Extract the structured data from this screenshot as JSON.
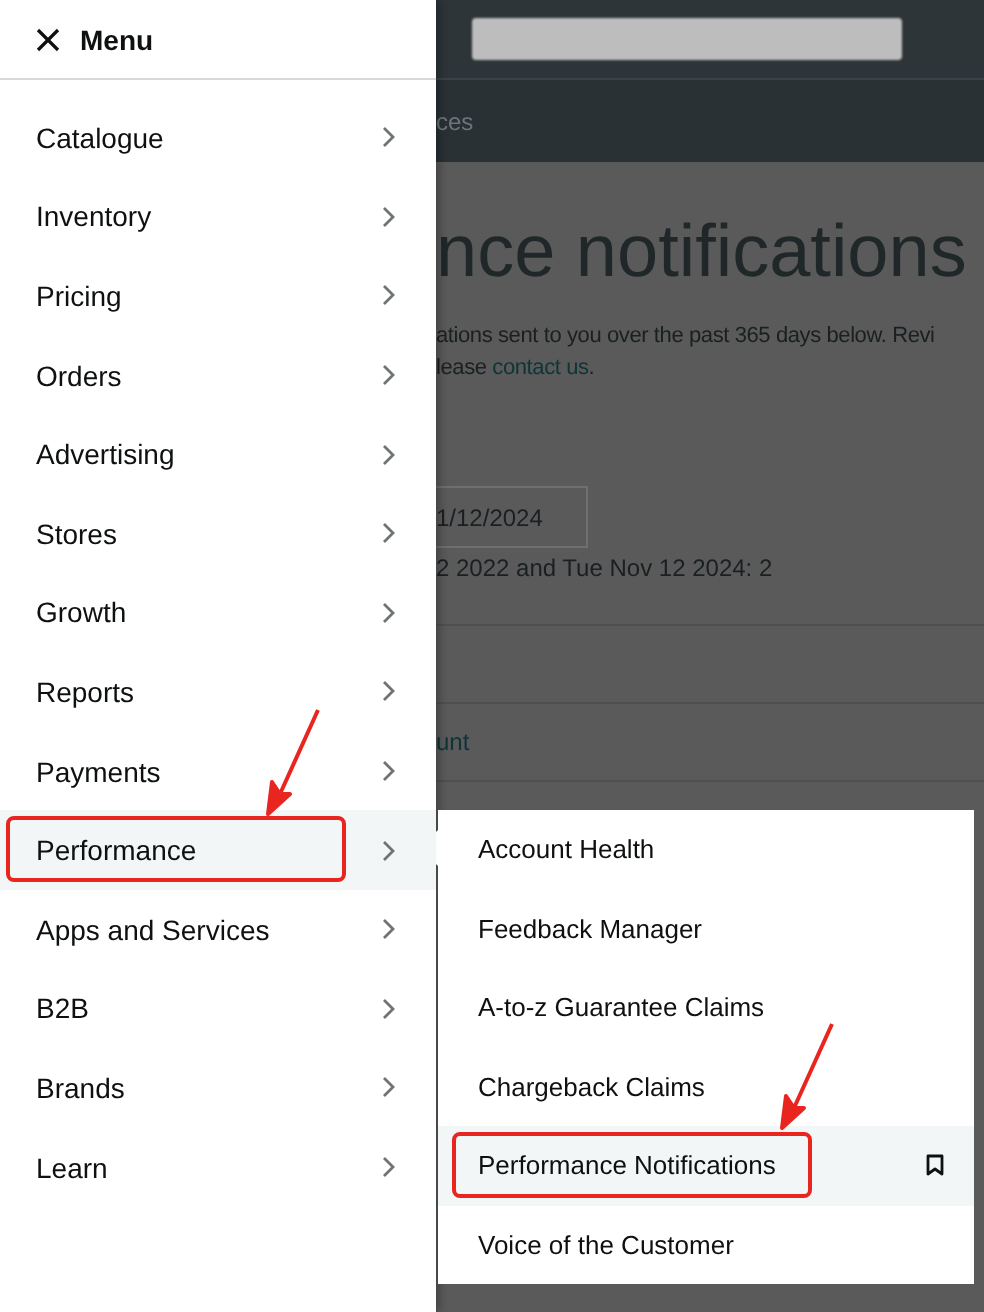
{
  "background_page": {
    "nav_text": "ces",
    "heading": "nce notifications",
    "intro_line": "ations sent to you over the past 365 days below. Revi",
    "contact_line": {
      "before": "lease ",
      "link": "contact us",
      "after": "."
    },
    "date_value": "1/12/2024",
    "count_text": "2 2022 and Tue Nov 12 2024: 2",
    "table_link": "unt"
  },
  "menu": {
    "title": "Menu",
    "items": [
      {
        "label": "Catalogue",
        "selected": false,
        "highlighted": false
      },
      {
        "label": "Inventory",
        "selected": false,
        "highlighted": false
      },
      {
        "label": "Pricing",
        "selected": false,
        "highlighted": false
      },
      {
        "label": "Orders",
        "selected": false,
        "highlighted": false
      },
      {
        "label": "Advertising",
        "selected": false,
        "highlighted": false
      },
      {
        "label": "Stores",
        "selected": false,
        "highlighted": false
      },
      {
        "label": "Growth",
        "selected": false,
        "highlighted": false
      },
      {
        "label": "Reports",
        "selected": false,
        "highlighted": false
      },
      {
        "label": "Payments",
        "selected": false,
        "highlighted": false
      },
      {
        "label": "Performance",
        "selected": true,
        "highlighted": true
      },
      {
        "label": "Apps and Services",
        "selected": false,
        "highlighted": false
      },
      {
        "label": "B2B",
        "selected": false,
        "highlighted": false
      },
      {
        "label": "Brands",
        "selected": false,
        "highlighted": false
      },
      {
        "label": "Learn",
        "selected": false,
        "highlighted": false
      }
    ]
  },
  "submenu": {
    "items": [
      {
        "label": "Account Health",
        "selected": false,
        "highlighted": false
      },
      {
        "label": "Feedback Manager",
        "selected": false,
        "highlighted": false
      },
      {
        "label": "A-to-z Guarantee Claims",
        "selected": false,
        "highlighted": false
      },
      {
        "label": "Chargeback Claims",
        "selected": false,
        "highlighted": false
      },
      {
        "label": "Performance Notifications",
        "selected": true,
        "highlighted": true
      },
      {
        "label": "Voice of the Customer",
        "selected": false,
        "highlighted": false
      }
    ]
  }
}
